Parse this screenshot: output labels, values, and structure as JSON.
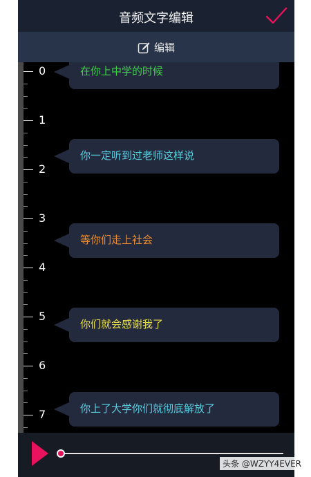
{
  "header": {
    "title": "音频文字编辑",
    "confirm_icon": "checkmark-icon",
    "accent_color": "#e8135c"
  },
  "toolbar": {
    "edit_label": "编辑",
    "edit_icon": "edit-icon"
  },
  "ruler": {
    "labels": [
      "0",
      "1",
      "2",
      "3",
      "4",
      "5",
      "6",
      "7"
    ]
  },
  "subtitles": [
    {
      "text": "在你上中学的时候",
      "color": "#3ed34a"
    },
    {
      "text": "你一定听到过老师这样说",
      "color": "#56cfe1"
    },
    {
      "text": "等你们走上社会",
      "color": "#ef8d2e"
    },
    {
      "text": "你们就会感谢我了",
      "color": "#e6dc4a"
    },
    {
      "text": "你上了大学你们就彻底解放了",
      "color": "#56cfe1"
    }
  ],
  "player": {
    "play_icon": "play-icon",
    "progress": 0.0
  },
  "watermark": "头条 @WZYY4EVER"
}
